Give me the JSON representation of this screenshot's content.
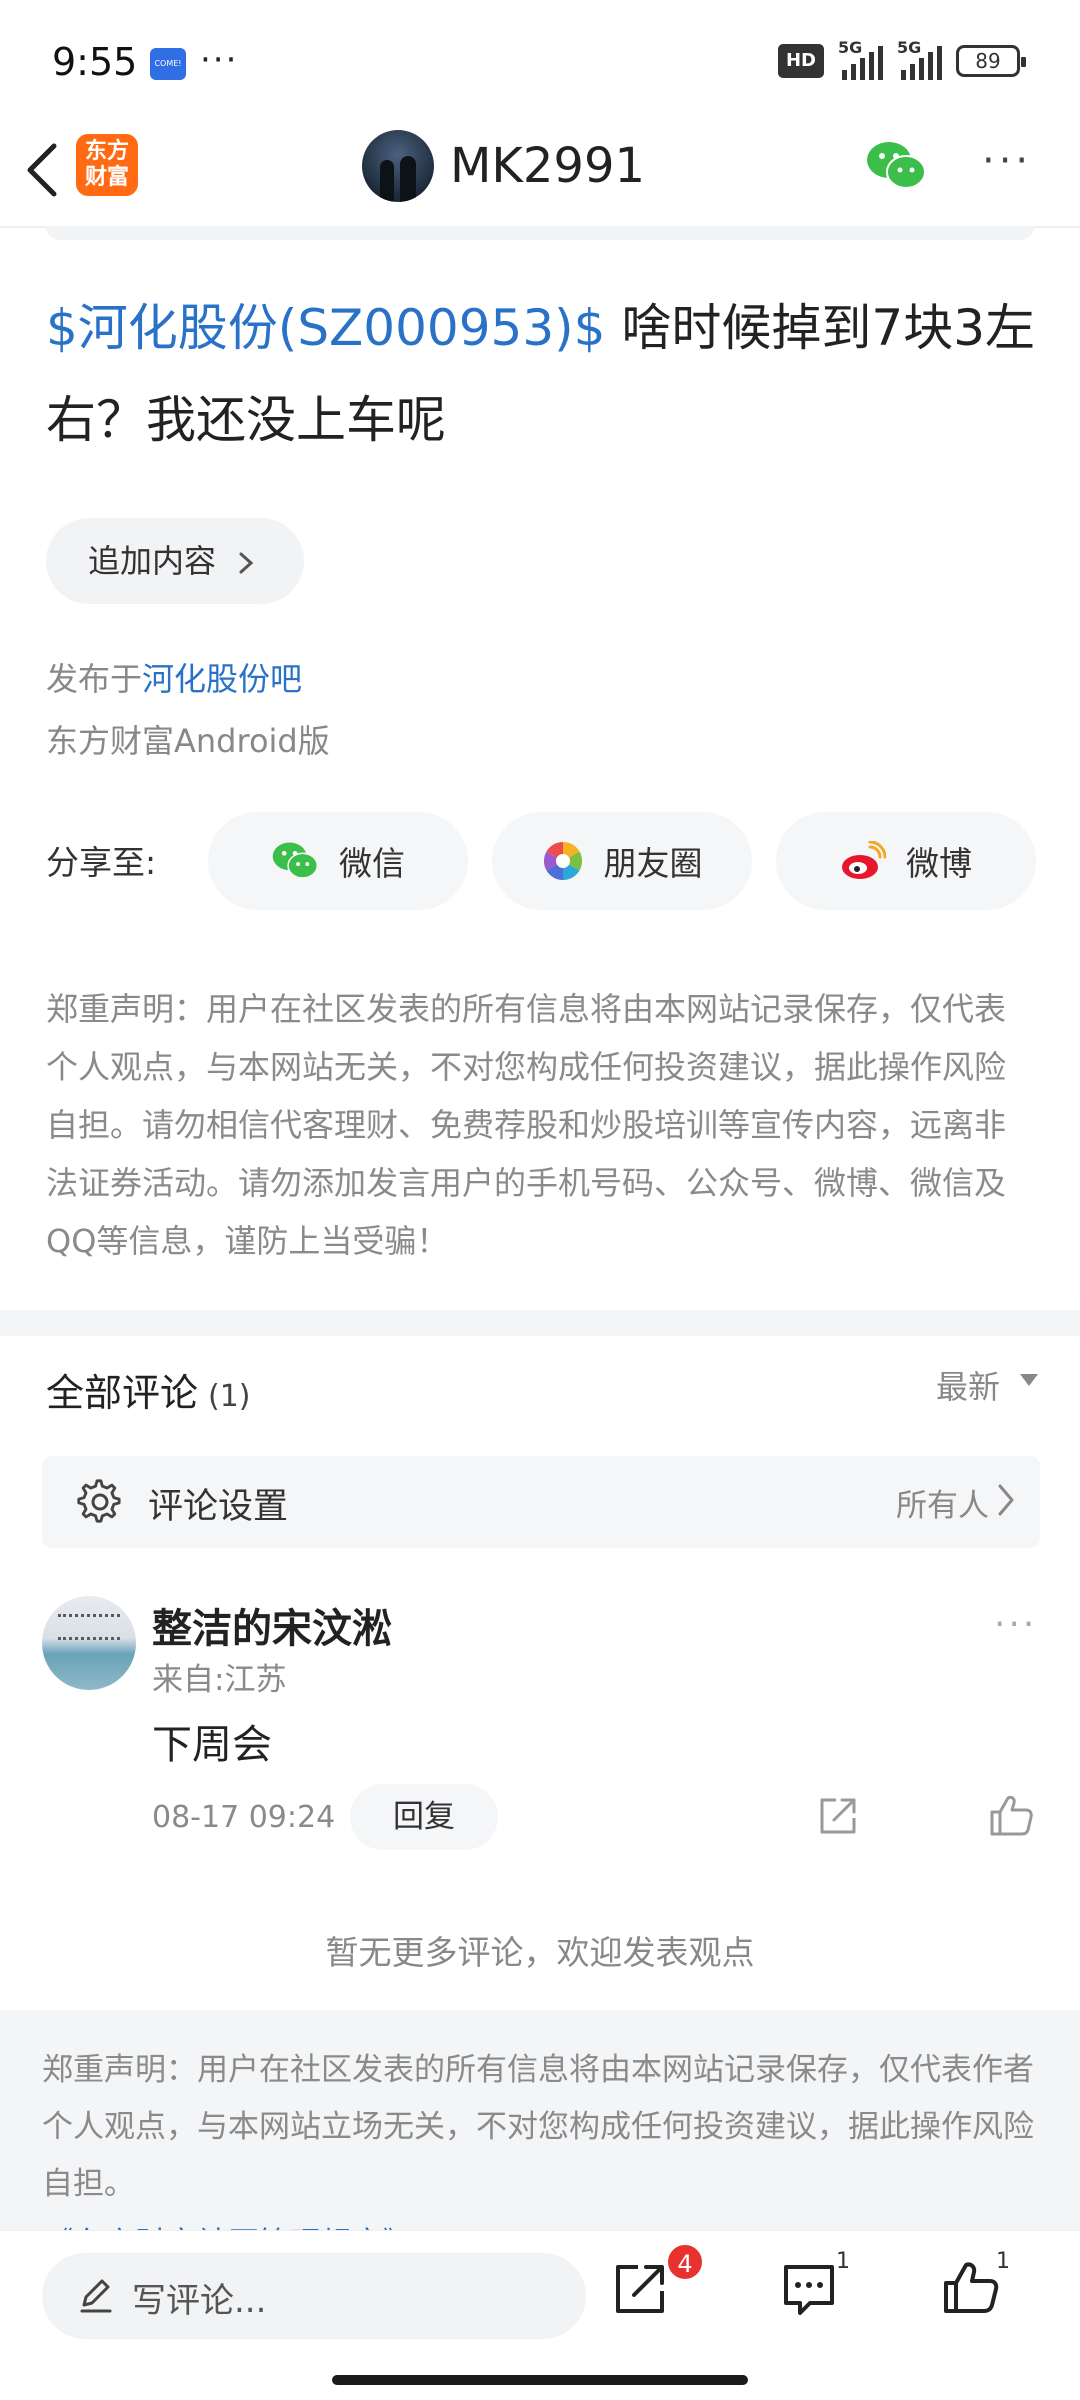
{
  "status_bar": {
    "time": "9:55",
    "app_icon_text": "COME!",
    "more": "···",
    "hd": "HD",
    "net1": "5G",
    "net2": "5G",
    "battery": "89"
  },
  "nav": {
    "brand_line1": "东方",
    "brand_line2": "财富",
    "username": "MK2991",
    "more": "···"
  },
  "post": {
    "stock": "$河化股份(SZ000953)$",
    "text": " 啥时候掉到7块3左右？我还没上车呢",
    "add_content": "追加内容",
    "published_prefix": "发布于",
    "published_bar": "河化股份吧",
    "platform": "东方财富Android版"
  },
  "share": {
    "label": "分享至:",
    "wechat": "微信",
    "moments": "朋友圈",
    "weibo": "微博"
  },
  "disclaimer": "郑重声明：用户在社区发表的所有信息将由本网站记录保存，仅代表个人观点，与本网站无关，不对您构成任何投资建议，据此操作风险自担。请勿相信代客理财、免费荐股和炒股培训等宣传内容，远离非法证券活动。请勿添加发言用户的手机号码、公众号、微博、微信及QQ等信息，谨防上当受骗！",
  "comments": {
    "title": "全部评论",
    "count": "(1)",
    "sort": "最新",
    "settings_label": "评论设置",
    "settings_value": "所有人",
    "items": [
      {
        "name": "整洁的宋汶淞",
        "location": "来自:江苏",
        "text": "下周会",
        "time": "08-17 09:24",
        "reply": "回复"
      }
    ],
    "no_more": "暂无更多评论，欢迎发表观点"
  },
  "footer": {
    "disclaimer": "郑重声明：用户在社区发表的所有信息将由本网站记录保存，仅代表作者个人观点，与本网站立场无关，不对您构成任何投资建议，据此操作风险自担。",
    "link": "《东方财富社区管理规定》"
  },
  "bottom_bar": {
    "write_placeholder": "写评论...",
    "share_badge": "4",
    "comment_count": "1",
    "like_count": "1"
  }
}
